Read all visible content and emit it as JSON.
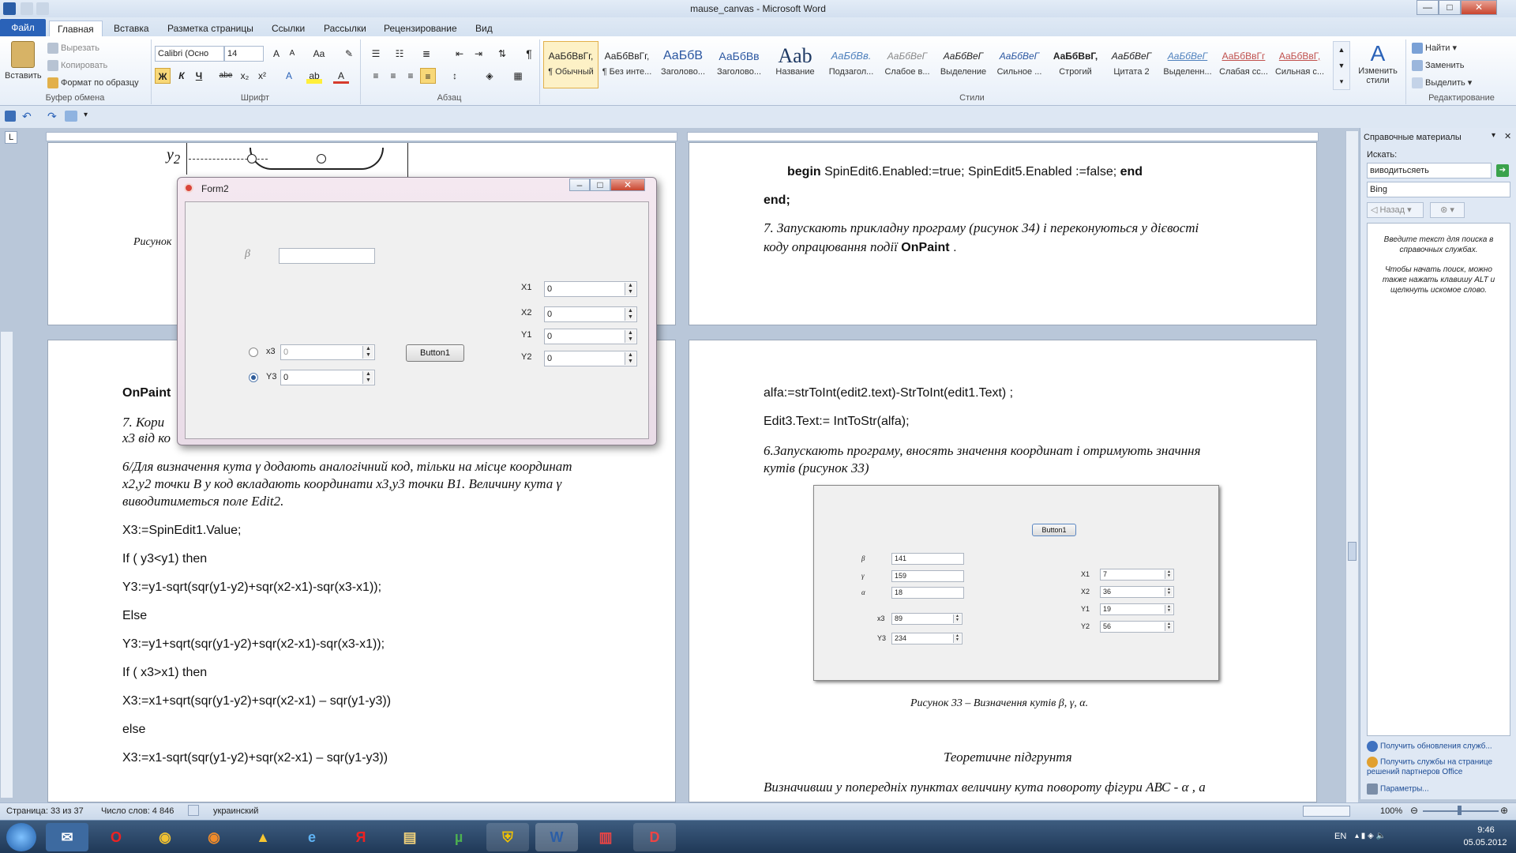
{
  "window": {
    "title": "mause_canvas - Microsoft Word",
    "min": "—",
    "max": "□",
    "close": "✕"
  },
  "tabs": [
    {
      "label": "Файл"
    },
    {
      "label": "Главная"
    },
    {
      "label": "Вставка"
    },
    {
      "label": "Разметка страницы"
    },
    {
      "label": "Ссылки"
    },
    {
      "label": "Рассылки"
    },
    {
      "label": "Рецензирование"
    },
    {
      "label": "Вид"
    }
  ],
  "clipboard": {
    "paste": "Вставить",
    "cut": "Вырезать",
    "copy": "Копировать",
    "format": "Формат по образцу",
    "group": "Буфер обмена"
  },
  "font": {
    "name": "Calibri (Осно",
    "size": "14",
    "group": "Шрифт",
    "bold": "Ж",
    "italic": "К",
    "underline": "Ч",
    "strike": "abe",
    "sub": "x₂",
    "sup": "x²"
  },
  "paragraph": {
    "group": "Абзац",
    "pilcrow": "¶"
  },
  "styles": {
    "group": "Стили",
    "items": [
      {
        "sample": "АаБбВвГг,",
        "name": "¶ Обычный"
      },
      {
        "sample": "АаБбВвГг,",
        "name": "¶ Без инте..."
      },
      {
        "sample": "АаБбВ",
        "name": "Заголово..."
      },
      {
        "sample": "АаБбВв",
        "name": "Заголово..."
      },
      {
        "sample": "Aab",
        "name": "Название"
      },
      {
        "sample": "АаБбВв.",
        "name": "Подзагол..."
      },
      {
        "sample": "АаБбВеГ",
        "name": "Слабое в..."
      },
      {
        "sample": "АаБбВеГ",
        "name": "Выделение"
      },
      {
        "sample": "АаБбВеГ",
        "name": "Сильное ..."
      },
      {
        "sample": "АаБбВвГ,",
        "name": "Строгий"
      },
      {
        "sample": "АаБбВеГ",
        "name": "Цитата 2"
      },
      {
        "sample": "АаБбВеГ",
        "name": "Выделенн..."
      },
      {
        "sample": "АаБбВвГг",
        "name": "Слабая сс..."
      },
      {
        "sample": "АаБбВвГ,",
        "name": "Сильная с..."
      }
    ],
    "change": "Изменить стили"
  },
  "editing": {
    "group": "Редактирование",
    "find": "Найти",
    "replace": "Заменить",
    "select": "Выделить"
  },
  "left_page_top": {
    "y2": "y",
    "y2_sub": "2",
    "caption": "Рисунок"
  },
  "right_page_top": {
    "line1_begin": "begin",
    "line1_mid": "SpinEdit6.Enabled:=true;  SpinEdit5.Enabled :=false;",
    "line1_end": "end",
    "line2": "end;",
    "para7": "7.  Запускають  прикладну  програму  (рисунок  34)  і  переконуються  у  дієвості",
    "para7b_pre": "коду  опрацювання  події",
    "para7b_bold": "OnPaint",
    "para7b_post": " ."
  },
  "form2": {
    "title": "Form2",
    "beta": "β",
    "x3_label": "x3",
    "x3_value": "0",
    "y3_label": "Y3",
    "y3_value": "0",
    "button": "Button1",
    "x1_label": "X1",
    "x1_value": "0",
    "x2_label": "X2",
    "x2_value": "0",
    "y1_label": "Y1",
    "y1_value": "0",
    "y2_label": "Y2",
    "y2_value": "0"
  },
  "left_page_bottom": {
    "onpaint": "OnPaint",
    "p7a": "7. Кори",
    "p7b": "x3 від ко",
    "p6a": "6/Для визначення кута γ додають аналогічний код, тільки на місце координат",
    "p6b": "x2,y2 точки В у код вкладають координати x3,y3 точки В1.  Величину кута γ",
    "p6c": "виводитиметься  поле Edit2.",
    "code": [
      "X3:=SpinEdit1.Value;",
      " If ( y3<y1) then",
      "Y3:=y1-sqrt(sqr(y1-y2)+sqr(x2-x1)-sqr(x3-x1));",
      "Else",
      "Y3:=y1+sqrt(sqr(y1-y2)+sqr(x2-x1)-sqr(x3-x1));",
      "If ( x3>x1) then",
      "X3:=x1+sqrt(sqr(y1-y2)+sqr(x2-x1) – sqr(y1-y3))",
      "else",
      "X3:=x1-sqrt(sqr(y1-y2)+sqr(x2-x1) – sqr(y1-y3))"
    ]
  },
  "right_page_bottom": {
    "alfa": "alfa:=strToInt(edit2.text)-StrToInt(edit1.Text) ;",
    "edit3": "Edit3.Text:= IntToStr(alfa);",
    "p6a": "6.Запускають  програму,  вносять  значення  координат  і  отримують  значння",
    "p6b": "кутів (рисунок 33)",
    "caption": "Рисунок 33 – Визначення кутів β, γ, α.",
    "heading": "Теоретичне підгрунтя",
    "last": "Визначивши   у попередніх пунктах величину кута повороту фігури АВС - α ,  а"
  },
  "figure33": {
    "button": "Button1",
    "beta": "β",
    "beta_val": "141",
    "gamma": "γ",
    "gamma_val": "159",
    "alpha": "α",
    "alpha_val": "18",
    "x3": "x3",
    "x3_val": "89",
    "y3": "Y3",
    "y3_val": "234",
    "x1": "X1",
    "x1_val": "7",
    "x2": "X2",
    "x2_val": "36",
    "y1": "Y1",
    "y1_val": "19",
    "y2": "Y2",
    "y2_val": "56"
  },
  "sidepane": {
    "title": "Справочные материалы",
    "search_label": "Искать:",
    "search_value": "виводитьсяеть",
    "source": "Bing",
    "back": "Назад",
    "hint1": "Введите текст для поиска в справочных службах.",
    "hint2": "Чтобы начать поиск, можно также нажать клавишу ALT и щелкнуть искомое слово.",
    "link1": "Получить обновления служб...",
    "link2": "Получить службы на странице решений партнеров Office",
    "link3": "Параметры..."
  },
  "status": {
    "page": "Страница: 33 из 37",
    "words": "Число слов: 4 846",
    "lang": "украинский",
    "zoom": "100%"
  },
  "taskbar": {
    "lang": "EN",
    "time": "9:46",
    "date": "05.05.2012"
  },
  "colors": {
    "accent": "#2a62b8",
    "taskbar": "#1f3857",
    "ribbon": "#e6eef8"
  }
}
